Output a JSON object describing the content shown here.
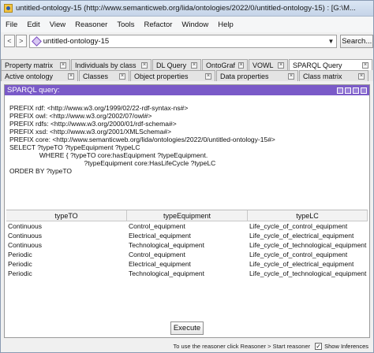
{
  "window": {
    "title": "untitled-ontology-15 (http://www.semanticweb.org/lida/ontologies/2022/0/untitled-ontology-15) : [G:\\M..."
  },
  "menu": [
    "File",
    "Edit",
    "View",
    "Reasoner",
    "Tools",
    "Refactor",
    "Window",
    "Help"
  ],
  "address": {
    "back": "<",
    "forward": ">",
    "ontology": "untitled-ontology-15",
    "search_label": "Search..."
  },
  "tabs_row1": [
    "Property matrix",
    "Individuals by class",
    "DL Query",
    "OntoGraf",
    "VOWL",
    "SPARQL Query"
  ],
  "tabs_row2": [
    "Active ontology",
    "Classes",
    "Object properties",
    "Data properties",
    "Class matrix"
  ],
  "sparql": {
    "header": "SPARQL query:",
    "query_lines": [
      "PREFIX rdf: <http://www.w3.org/1999/02/22-rdf-syntax-ns#>",
      "PREFIX owl: <http://www.w3.org/2002/07/owl#>",
      "PREFIX rdfs: <http://www.w3.org/2000/01/rdf-schema#>",
      "PREFIX xsd: <http://www.w3.org/2001/XMLSchema#>",
      "PREFIX core: <http://www.semanticweb.org/lida/ontologies/2022/0/untitled-ontology-15#>",
      "SELECT ?typeTO ?typeEquipment ?typeLC",
      "                WHERE { ?typeTO core:hasEquipment ?typeEquipment.",
      "                                        ?typeEquipment core:HasLifeCycle ?typeLC",
      "",
      "ORDER BY ?typeTO"
    ],
    "columns": [
      "typeTO",
      "typeEquipment",
      "typeLC"
    ],
    "rows": [
      [
        "Continuous",
        "Control_equipment",
        "Life_cycle_of_control_equipment"
      ],
      [
        "Continuous",
        "Electrical_equipment",
        "Life_cycle_of_electrical_equipment"
      ],
      [
        "Continuous",
        "Technological_equipment",
        "Life_cycle_of_technological_equipment"
      ],
      [
        "Periodic",
        "Control_equipment",
        "Life_cycle_of_control_equipment"
      ],
      [
        "Periodic",
        "Electrical_equipment",
        "Life_cycle_of_electrical_equipment"
      ],
      [
        "Periodic",
        "Technological_equipment",
        "Life_cycle_of_technological_equipment"
      ]
    ],
    "execute_label": "Execute"
  },
  "status": {
    "hint": "To use the reasoner click Reasoner > Start reasoner",
    "show_inferences_label": "Show Inferences",
    "show_inferences_checked": true
  }
}
